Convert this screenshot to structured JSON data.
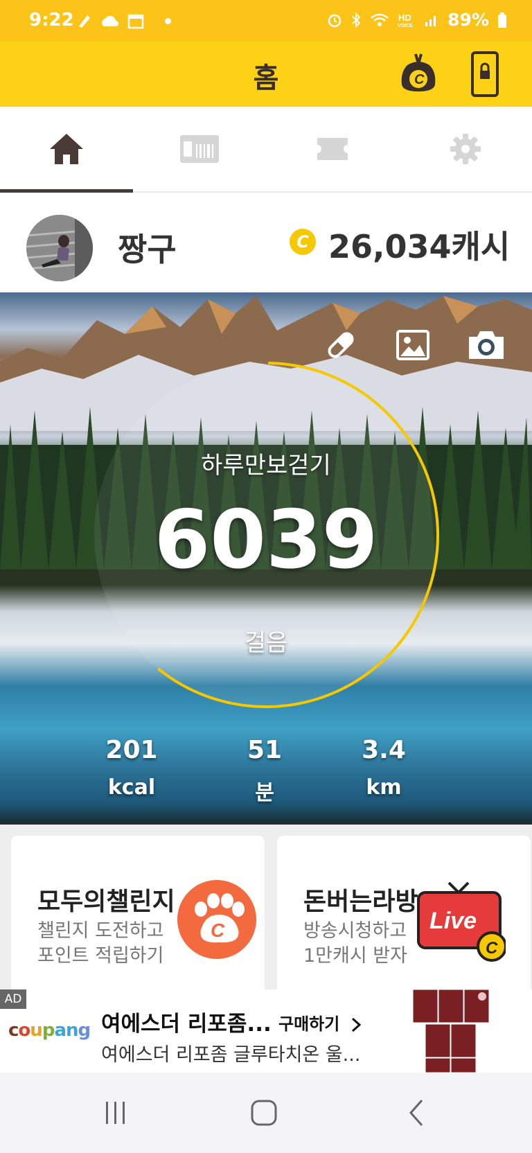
{
  "status_bar": {
    "time": "9:22",
    "battery": "89%",
    "icons": [
      "pen-icon",
      "cloud-icon",
      "calendar-icon",
      "dot-icon",
      "alarm-icon",
      "bluetooth-icon",
      "wifi-icon",
      "hd-voice-icon",
      "signal-icon",
      "battery-icon"
    ]
  },
  "app_bar": {
    "title": "홈",
    "icons": [
      "cash-bag-icon",
      "lock-screen-icon"
    ]
  },
  "tabs": [
    {
      "name": "home",
      "icon": "home-icon",
      "active": true
    },
    {
      "name": "gift",
      "icon": "gift-card-icon",
      "active": false
    },
    {
      "name": "ticket",
      "icon": "ticket-icon",
      "active": false
    },
    {
      "name": "settings",
      "icon": "gear-icon",
      "active": false
    }
  ],
  "profile": {
    "username": "짱구",
    "coin_letter": "C",
    "cash": "26,034캐시"
  },
  "walk": {
    "title": "하루만보걷기",
    "steps": "6039",
    "unit": "걸음",
    "goal_progress": 0.6039,
    "icons": [
      "pill-icon",
      "image-icon",
      "camera-icon"
    ]
  },
  "stats": [
    {
      "value": "201",
      "unit": "kcal"
    },
    {
      "value": "51",
      "unit": "분"
    },
    {
      "value": "3.4",
      "unit": "km"
    }
  ],
  "cards": [
    {
      "title": "모두의챌린지",
      "sub1": "챌린지 도전하고",
      "sub2": "포인트 적립하기",
      "icon": "paw-coin-icon"
    },
    {
      "title": "돈버는라방",
      "sub1": "방송시청하고",
      "sub2": "1만캐시 받자",
      "icon": "live-tv-icon",
      "badge": "Live"
    }
  ],
  "ad": {
    "tag": "AD",
    "brand": "coupang",
    "title": "여에스더 리포좀...",
    "buy": "구매하기",
    "desc": "여에스더 리포좀 글루타치온 울..."
  },
  "colors": {
    "accent_yellow": "#fcd116",
    "status_yellow": "#fcc419",
    "brown": "#4a3b36",
    "ring_yellow": "#f5c800",
    "paw_orange": "#f26a3d",
    "live_red": "#e63b3b"
  }
}
